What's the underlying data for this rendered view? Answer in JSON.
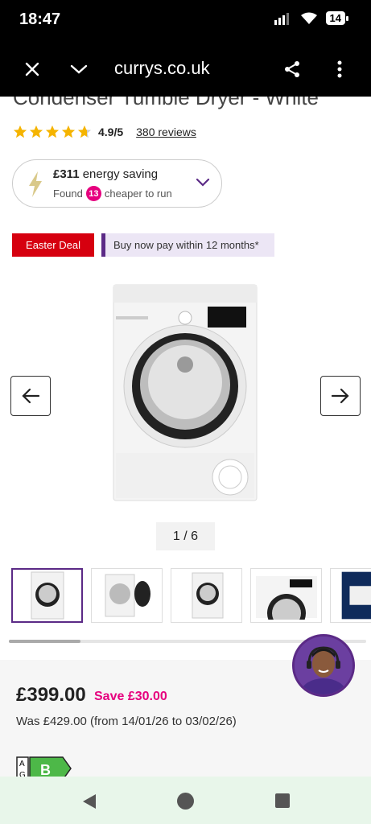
{
  "status": {
    "time": "18:47",
    "battery": "14"
  },
  "browser": {
    "url": "currys.co.uk"
  },
  "product": {
    "title": "Condenser Tumble Dryer - White",
    "rating_value": "4.9/5",
    "reviews": "380 reviews",
    "rating_stars": 4.9
  },
  "energy": {
    "saving": "£311",
    "saving_text": "energy saving",
    "found_text": "Found",
    "cheaper_count": "13",
    "cheaper_text": "cheaper to run"
  },
  "tags": {
    "deal": "Easter Deal",
    "bnpl": "Buy now pay within 12 months*"
  },
  "gallery": {
    "counter": "1 / 6",
    "progress": 0.2
  },
  "pricing": {
    "price": "£399.00",
    "save": "Save £30.00",
    "was": "Was £429.00 (from 14/01/26 to 03/02/26)",
    "energy_class": "B",
    "energy_scale_top": "A",
    "energy_scale_bottom": "G"
  },
  "colors": {
    "brand_purple": "#5b2a86",
    "brand_pink": "#e6007e",
    "deal_red": "#d6000f"
  }
}
